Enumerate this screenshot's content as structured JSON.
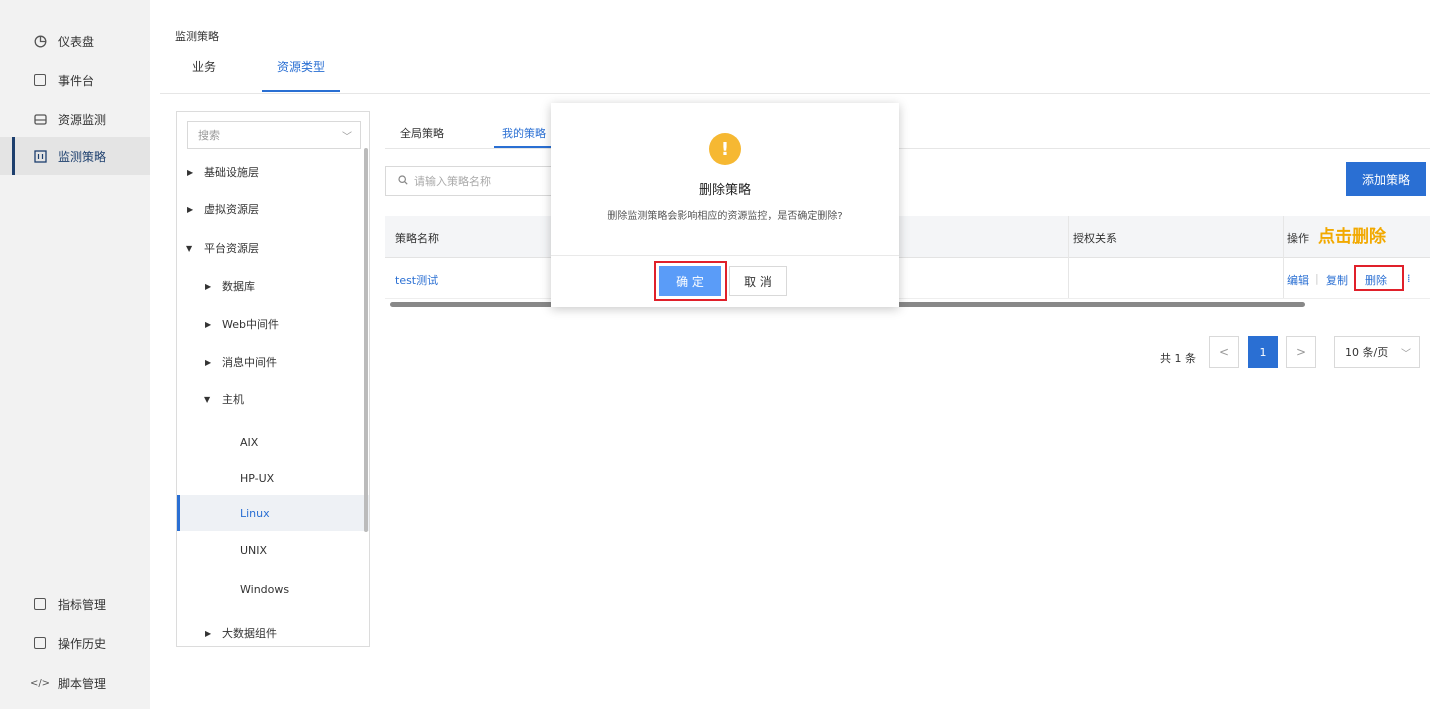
{
  "nav": {
    "top_items": [
      {
        "label": "仪表盘",
        "icon": "dashboard-icon"
      },
      {
        "label": "事件台",
        "icon": "event-icon"
      },
      {
        "label": "资源监测",
        "icon": "resource-monitor-icon"
      },
      {
        "label": "监测策略",
        "icon": "policy-icon"
      }
    ],
    "bottom_items": [
      {
        "label": "指标管理",
        "icon": "metrics-icon"
      },
      {
        "label": "操作历史",
        "icon": "history-icon"
      },
      {
        "label": "脚本管理",
        "icon": "code-icon"
      }
    ]
  },
  "header": {
    "breadcrumb": "监测策略",
    "tabs": [
      {
        "label": "业务"
      },
      {
        "label": "资源类型"
      }
    ],
    "active_tab": "资源类型"
  },
  "tree": {
    "search_placeholder": "搜索",
    "nodes": [
      {
        "label": "基础设施层",
        "expanded": false
      },
      {
        "label": "虚拟资源层",
        "expanded": false
      },
      {
        "label": "平台资源层",
        "expanded": true
      },
      {
        "label": "数据库",
        "expanded": false
      },
      {
        "label": "Web中间件",
        "expanded": false
      },
      {
        "label": "消息中间件",
        "expanded": false
      },
      {
        "label": "主机",
        "expanded": true
      },
      {
        "label": "AIX"
      },
      {
        "label": "HP-UX"
      },
      {
        "label": "Linux",
        "selected": true
      },
      {
        "label": "UNIX"
      },
      {
        "label": "Windows"
      },
      {
        "label": "大数据组件",
        "expanded": false
      }
    ]
  },
  "content": {
    "subtabs": [
      {
        "label": "全局策略"
      },
      {
        "label": "我的策略"
      }
    ],
    "search_placeholder": "请输入策略名称",
    "add_button": "添加策略",
    "columns": {
      "name": "策略名称",
      "auth": "授权关系",
      "ops": "操作"
    },
    "rows": [
      {
        "name": "test测试",
        "auth": "",
        "actions": {
          "edit": "编辑",
          "copy": "复制",
          "delete": "删除"
        }
      }
    ],
    "pagination": {
      "total": "共 1 条",
      "prev": "<",
      "current": "1",
      "next": ">",
      "page_size": "10 条/页"
    }
  },
  "dialog": {
    "icon": "warning-icon",
    "title": "删除策略",
    "message": "删除监测策略会影响相应的资源监控，是否确定删除?",
    "confirm": "确 定",
    "cancel": "取 消"
  },
  "annotation": {
    "hint": "点击删除"
  },
  "colors": {
    "primary": "#2a6fd3",
    "warning": "#f6b832",
    "highlight": "#e0202a",
    "hint": "#f2a900"
  }
}
